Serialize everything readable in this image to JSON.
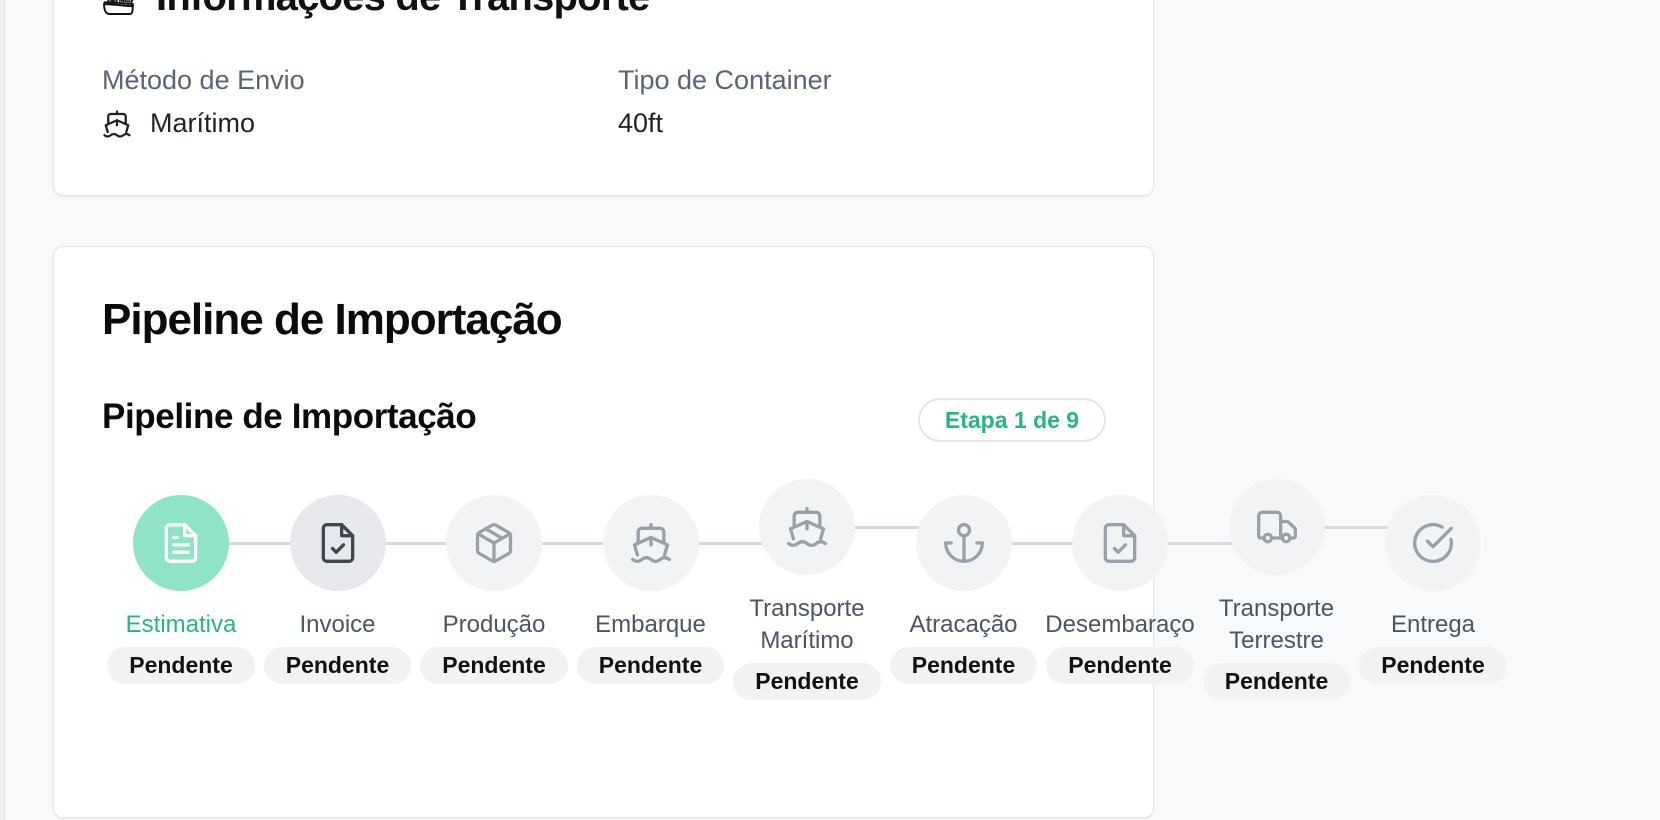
{
  "transport_card": {
    "title": "Informações de Transporte",
    "title_icon": "ship-icon",
    "shipping_method_label": "Método de Envio",
    "shipping_method_value": "Marítimo",
    "shipping_method_icon": "ship-icon",
    "container_type_label": "Tipo de Container",
    "container_type_value": "40ft"
  },
  "pipeline_card": {
    "title": "Pipeline de Importação",
    "subtitle": "Pipeline de Importação",
    "stage_badge": "Etapa 1 de 9",
    "colors": {
      "accent": "#2bb57e",
      "active_circle": "#8ee4c4",
      "connector": "#d7dbe0"
    },
    "steps": [
      {
        "label": "Estimativa",
        "status": "Pendente",
        "icon": "document-icon",
        "state": "active"
      },
      {
        "label": "Invoice",
        "status": "Pendente",
        "icon": "file-check-icon",
        "state": "current"
      },
      {
        "label": "Produção",
        "status": "Pendente",
        "icon": "package-icon",
        "state": "pending"
      },
      {
        "label": "Embarque",
        "status": "Pendente",
        "icon": "ship-icon",
        "state": "pending"
      },
      {
        "label": "Transporte Marítimo",
        "status": "Pendente",
        "icon": "ship-icon",
        "state": "pending"
      },
      {
        "label": "Atracação",
        "status": "Pendente",
        "icon": "anchor-icon",
        "state": "pending"
      },
      {
        "label": "Desembaraço",
        "status": "Pendente",
        "icon": "file-check-icon",
        "state": "pending"
      },
      {
        "label": "Transporte Terrestre",
        "status": "Pendente",
        "icon": "truck-icon",
        "state": "pending"
      },
      {
        "label": "Entrega",
        "status": "Pendente",
        "icon": "check-circle-icon",
        "state": "pending"
      }
    ]
  }
}
